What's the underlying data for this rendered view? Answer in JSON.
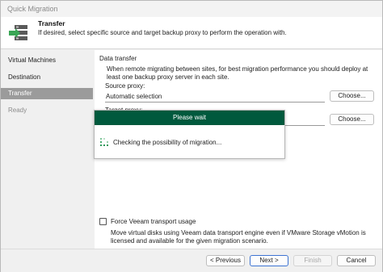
{
  "window": {
    "title": "Quick Migration"
  },
  "header": {
    "title": "Transfer",
    "description": "If desired, select specific source and target backup proxy to perform the operation with."
  },
  "sidebar": {
    "items": [
      {
        "label": "Virtual Machines",
        "state": "normal"
      },
      {
        "label": "Destination",
        "state": "normal"
      },
      {
        "label": "Transfer",
        "state": "active"
      },
      {
        "label": "Ready",
        "state": "disabled"
      }
    ]
  },
  "transfer": {
    "section_title": "Data transfer",
    "description": "When remote migrating between sites, for best migration performance you should deploy at least one backup proxy server in each site.",
    "source_proxy_label": "Source proxy:",
    "source_proxy_value": "Automatic selection",
    "target_proxy_label": "Target proxy:",
    "target_proxy_value": "",
    "choose_label": "Choose..."
  },
  "force_transport": {
    "label": "Force Veeam transport usage",
    "checked": false,
    "description": "Move virtual disks using Veeam data transport engine even if VMware Storage vMotion is licensed and available for the given migration scenario."
  },
  "footer": {
    "previous": "< Previous",
    "next": "Next >",
    "finish": "Finish",
    "cancel": "Cancel"
  },
  "wait_dialog": {
    "title": "Please wait",
    "message": "Checking the possibility of migration...",
    "title_color": "#00593D"
  },
  "colors": {
    "brand_green": "#00593D",
    "nav_active_bg": "#9B9B9B",
    "primary_button_border": "#3E74D2"
  }
}
